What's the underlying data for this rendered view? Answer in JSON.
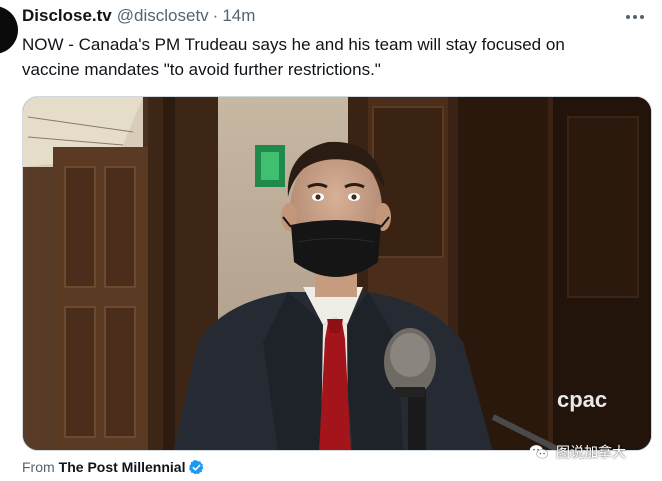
{
  "tweet": {
    "display_name": "Disclose.tv",
    "handle": "@disclosetv",
    "separator": "·",
    "time": "14m",
    "text_line1": "NOW - Canada's PM Trudeau says he and his team will stay focused on",
    "text_line2": "vaccine mandates \"to avoid further restrictions.\""
  },
  "media": {
    "broadcaster_logo": "cpac",
    "type": "video"
  },
  "attribution": {
    "label": "From",
    "source": "The Post Millennial",
    "verified_icon": "verified-badge-icon"
  },
  "watermark": {
    "text": "图说加拿大",
    "icon": "wechat-icon"
  },
  "colors": {
    "text_primary": "#0f1419",
    "text_secondary": "#536471",
    "verified_blue": "#1d9bf0",
    "border": "#cfd9de"
  }
}
